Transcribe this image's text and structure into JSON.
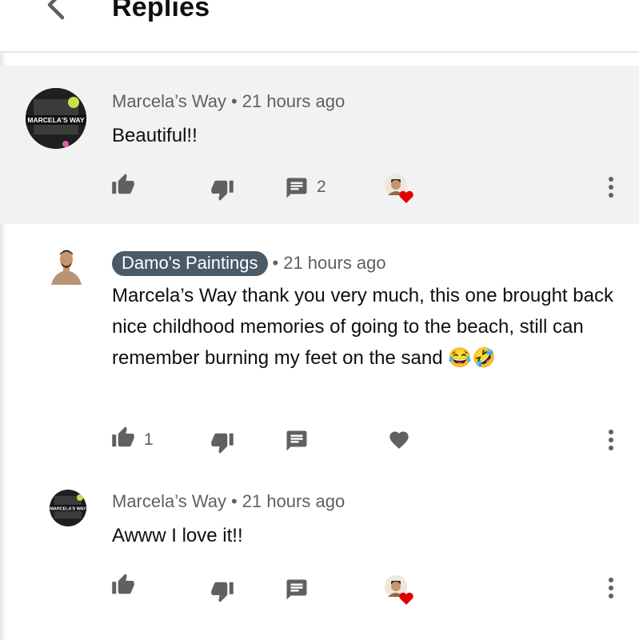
{
  "header": {
    "title": "Replies"
  },
  "comments": [
    {
      "author": "Marcela’s Way",
      "separator": "•",
      "time": "21 hours ago",
      "text": "Beautiful!!",
      "reply_count": "2",
      "avatar_text": "MARCELA'S WAY"
    },
    {
      "author": "Damo's Paintings",
      "separator": "•",
      "time": "21 hours ago",
      "text": "Marcela’s Way thank you very much, this one brought back nice childhood memories of going to the beach, still can remember burning my feet on the sand",
      "emoji": "😂🤣",
      "like_count": "1"
    },
    {
      "author": "Marcela’s Way",
      "separator": "•",
      "time": "21 hours ago",
      "text": "Awww I love it!!",
      "avatar_text": "MARCELA'S WAY"
    }
  ],
  "colors": {
    "highlight_bg": "#f2f2f2",
    "icon_gray": "#606060",
    "author_badge_bg": "#4a5a67",
    "heart_red": "#e00000"
  }
}
